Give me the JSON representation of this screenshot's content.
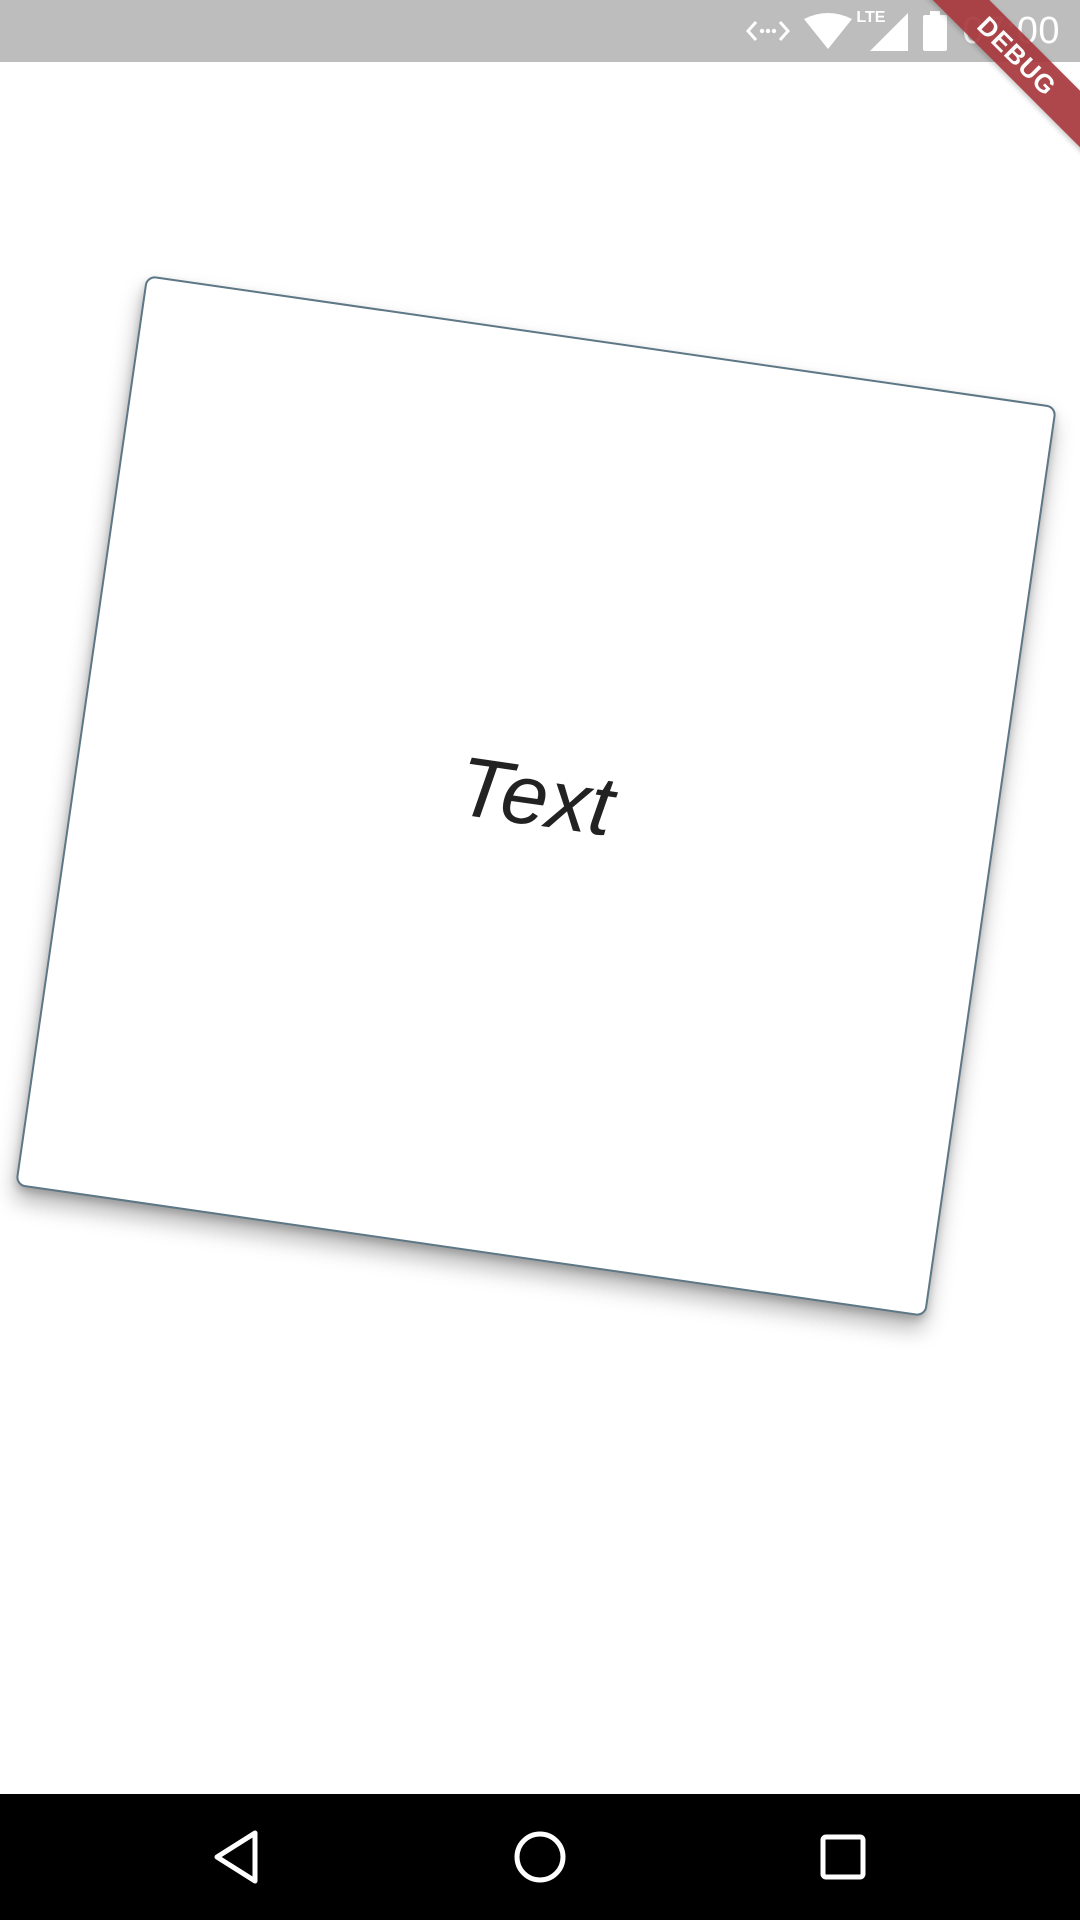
{
  "status_bar": {
    "time": "07:00",
    "icons": [
      "data-transfer-icon",
      "wifi-icon",
      "lte-signal-icon",
      "battery-icon"
    ],
    "lte_label": "LTE"
  },
  "debug_banner": {
    "label": "DEBUG",
    "color": "#a8383c"
  },
  "card": {
    "text": "Text",
    "border_color": "#5d7785"
  },
  "nav_bar": {
    "buttons": [
      "back-icon",
      "home-icon",
      "recents-icon"
    ]
  }
}
